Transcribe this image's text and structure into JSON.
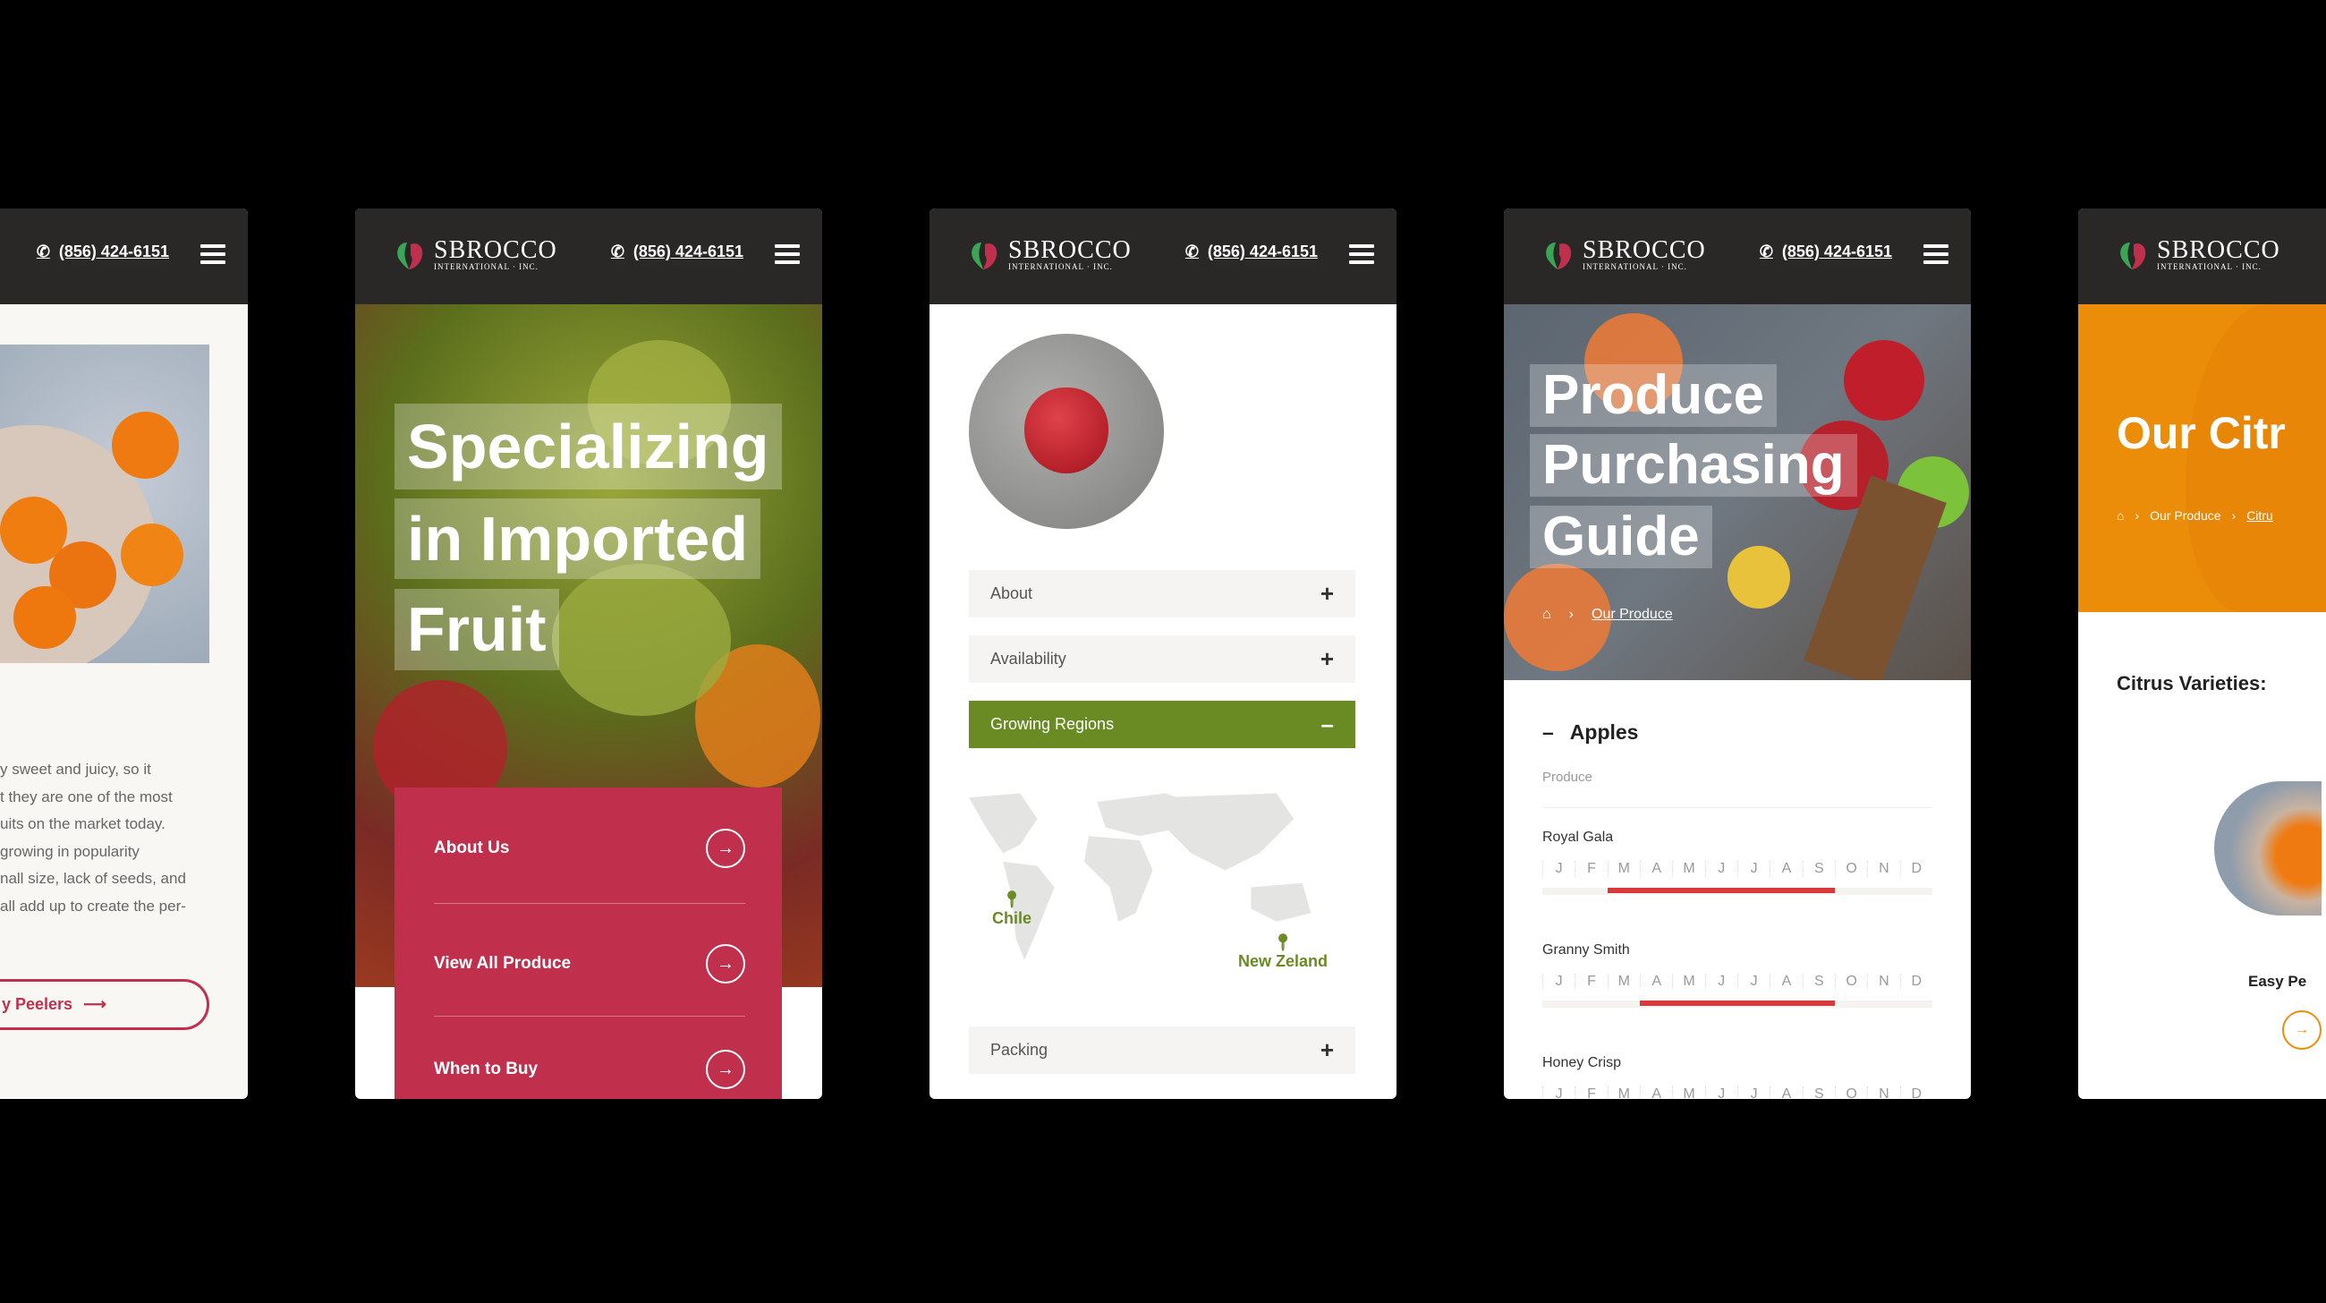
{
  "brand": {
    "name": "SBROCCO",
    "sub": "INTERNATIONAL · INC.",
    "phone": "(856) 424-6151"
  },
  "colors": {
    "header": "#2a2826",
    "crimson": "#c0304c",
    "green": "#6a8a23",
    "orange": "#ec8d0a"
  },
  "panel1": {
    "text_lines": [
      "y sweet and juicy, so it",
      "t they are one of the most",
      "uits on the market today.",
      "growing in popularity",
      "nall size, lack of seeds, and",
      "all add up to create the per-"
    ],
    "button": "y Peelers"
  },
  "panel2": {
    "title_lines": [
      "Specializing",
      "in Imported",
      "Fruit"
    ],
    "menu": [
      {
        "label": "About Us"
      },
      {
        "label": "View All Produce"
      },
      {
        "label": "When to Buy"
      }
    ]
  },
  "panel3": {
    "accordion": [
      {
        "label": "About",
        "icon": "plus"
      },
      {
        "label": "Availability",
        "icon": "plus"
      },
      {
        "label": "Growing Regions",
        "icon": "minus",
        "active": true
      },
      {
        "label": "Packing",
        "icon": "plus"
      }
    ],
    "map_pins": [
      "Chile",
      "New Zeland"
    ]
  },
  "panel4": {
    "title_lines": [
      "Produce",
      "Purchasing",
      "Guide"
    ],
    "breadcrumb": "Our Produce",
    "section": "Apples",
    "subheading": "Produce",
    "months": [
      "J",
      "F",
      "M",
      "A",
      "M",
      "J",
      "J",
      "A",
      "S",
      "O",
      "N",
      "D"
    ],
    "varieties": [
      {
        "name": "Royal Gala",
        "season": [
          "Mar",
          "Sep"
        ]
      },
      {
        "name": "Granny Smith",
        "season": [
          "Apr",
          "Sep"
        ]
      },
      {
        "name": "Honey Crisp"
      }
    ]
  },
  "panel5": {
    "title": "Our Citr",
    "breadcrumb": [
      "Our Produce",
      "Citru"
    ],
    "heading": "Citrus Varieties:",
    "card": "Easy Pe"
  }
}
